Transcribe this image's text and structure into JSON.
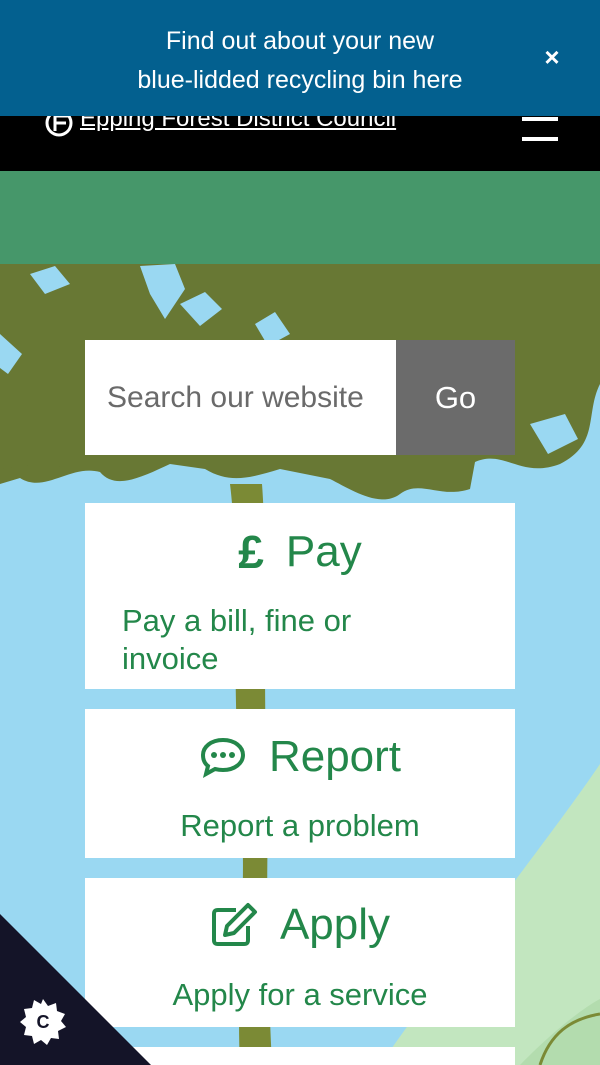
{
  "banner": {
    "line1": "Find out about your new",
    "line2": "blue-lidded recycling bin here",
    "close_label": "×"
  },
  "header": {
    "council_name": "Epping Forest District Council"
  },
  "search": {
    "placeholder": "Search our website",
    "button_label": "Go"
  },
  "cards": [
    {
      "title": "Pay",
      "icon": "pound-icon",
      "description": "Pay a bill, fine or invoice"
    },
    {
      "title": "Report",
      "icon": "speech-bubble-icon",
      "description": "Report a problem"
    },
    {
      "title": "Apply",
      "icon": "edit-icon",
      "description": "Apply for a service"
    }
  ],
  "cookie": {
    "icon": "gear-icon",
    "letter": "C"
  },
  "colors": {
    "banner": "#03608f",
    "header": "#000000",
    "band": "#46976a",
    "sky": "#9ad8f2",
    "tree": "#687834",
    "card_text": "#23874a",
    "go_button": "#6b6b6b"
  }
}
